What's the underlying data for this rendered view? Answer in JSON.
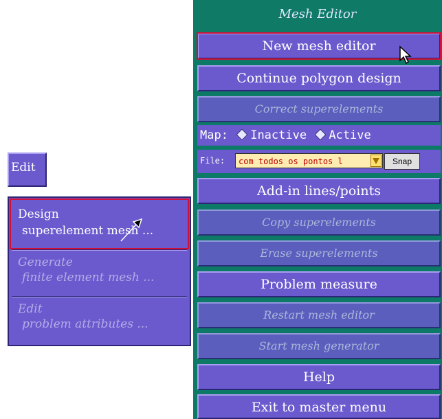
{
  "left_menu": {
    "edit_tab": "Edit",
    "items": [
      {
        "line1": "Design",
        "line2": "superelement mesh ..."
      },
      {
        "line1": "Generate",
        "line2": "finite element mesh ..."
      },
      {
        "line1": "Edit",
        "line2": "problem attributes ..."
      }
    ]
  },
  "panel": {
    "title": "Mesh Editor",
    "buttons": [
      "New mesh editor",
      "Continue polygon design",
      "Correct superelements",
      "Add-in lines/points",
      "Copy superelements",
      "Erase superelements",
      "Problem measure",
      "Restart mesh editor",
      "Start mesh generator",
      "Help",
      "Exit to master menu"
    ],
    "map_label": "Map:",
    "map_opt1": "Inactive",
    "map_opt2": "Active",
    "file_label": "File:",
    "file_value": "com todos os pontos l",
    "snap_label": "Snap"
  }
}
